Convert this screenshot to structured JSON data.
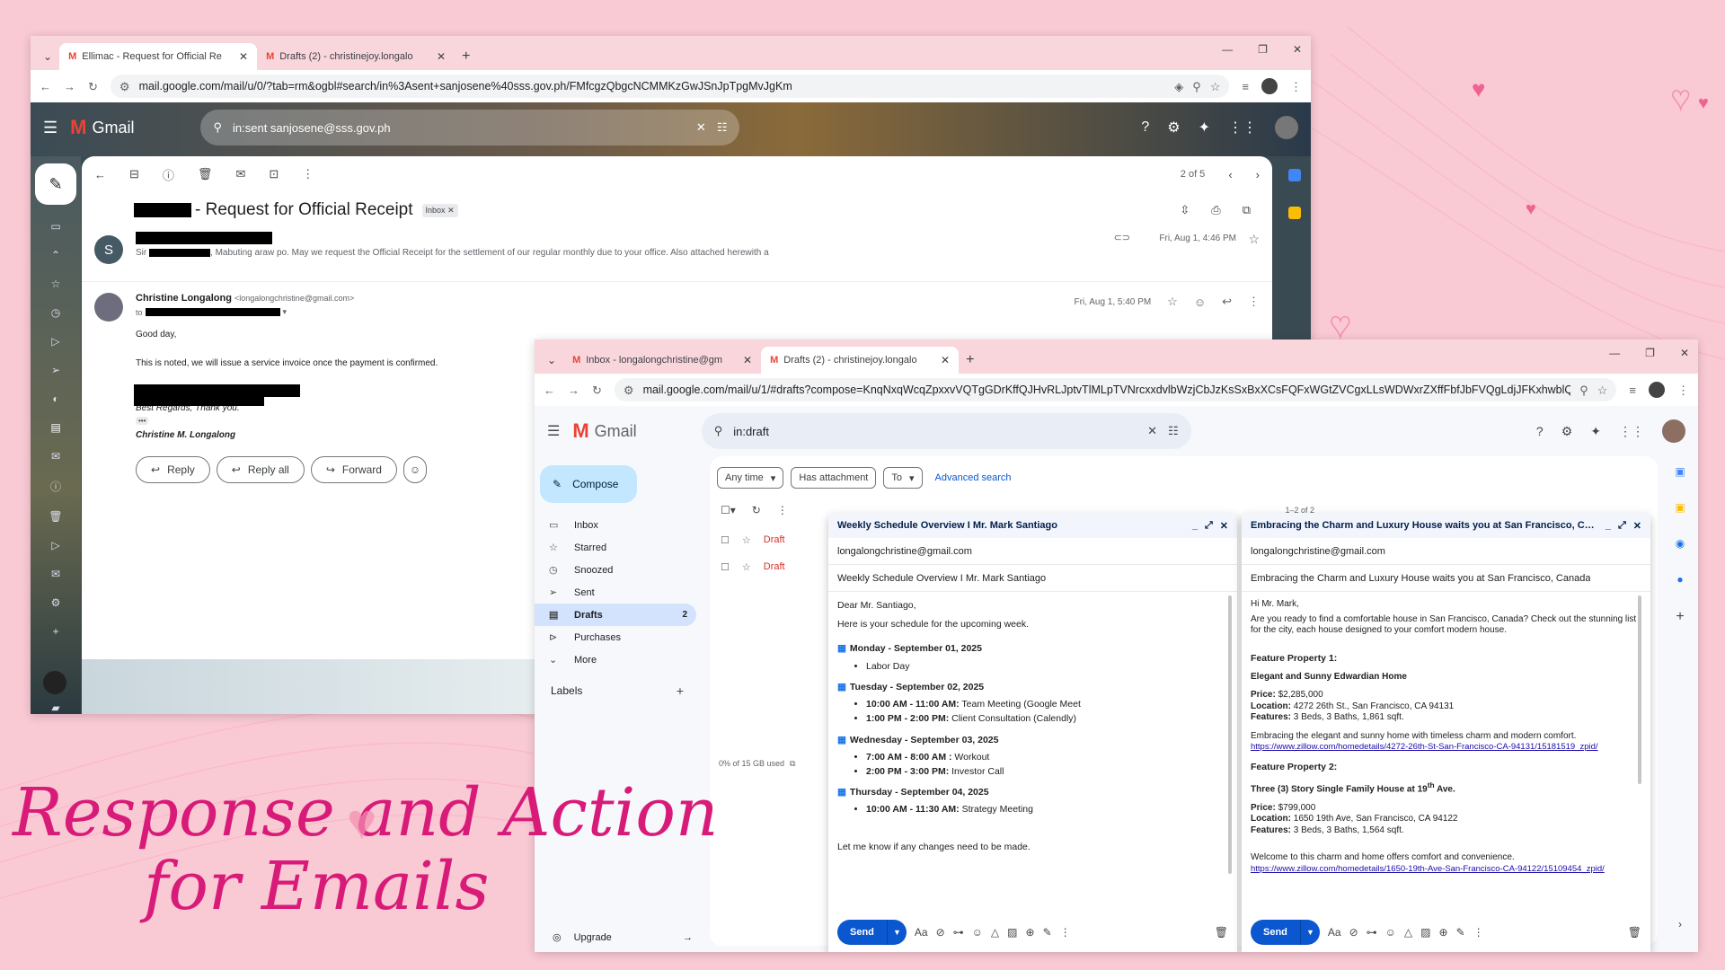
{
  "back_window": {
    "tabs": [
      {
        "label": "Ellimac - Request for Official Re",
        "active": true
      },
      {
        "label": "Drafts (2) - christinejoy.longalo",
        "active": false
      }
    ],
    "url": "mail.google.com/mail/u/0/?tab=rm&ogbl#search/in%3Asent+sanjosene%40sss.gov.ph/FMfcgzQbgcNCMMKzGwJSnJpTpgMvJgKm",
    "app_name": "Gmail",
    "search_query": "in:sent sanjosene@sss.gov.ph",
    "pagination": "2 of 5",
    "subject": "- Request for Official Receipt",
    "inbox_chip": "Inbox",
    "msg1": {
      "avatar_letter": "S",
      "preview_prefix": "Sir",
      "preview": ", Mabuting araw po. May we request the Official Receipt for the settlement of our regular monthly due to your office. Also attached herewith a",
      "time": "Fri, Aug 1, 4:46 PM"
    },
    "msg2": {
      "sender_name": "Christine Longalong",
      "sender_email": "<longalongchristine@gmail.com>",
      "to_prefix": "to",
      "time": "Fri, Aug 1, 5:40 PM",
      "greeting": "Good day,",
      "body": "This is noted, we will issue a service invoice once the payment is confirmed.",
      "closing": "Best Regards, Thank you.",
      "signature": "Christine M. Longalong",
      "ellipsis": "•••"
    },
    "actions": {
      "reply": "Reply",
      "reply_all": "Reply all",
      "forward": "Forward"
    }
  },
  "front_window": {
    "tabs": [
      {
        "label": "Inbox - longalongchristine@gm",
        "active": false
      },
      {
        "label": "Drafts (2) - christinejoy.longalo",
        "active": true
      }
    ],
    "url": "mail.google.com/mail/u/1/#drafts?compose=KnqNxqWcqZpxxvVQTgGDrKffQJHvRLJptvTlMLpTVNrcxxdvlbWzjCbJzKsSxBxXCsFQFxWGtZVCgxLLsWDWxrZXffFbfJbFVQgLdjJFKxhwblQHwkVcpR",
    "app_name": "Gmail",
    "search_query": "in:draft",
    "compose_label": "Compose",
    "nav": [
      {
        "label": "Inbox",
        "icon": "inbox-icon",
        "count": ""
      },
      {
        "label": "Starred",
        "icon": "star-icon",
        "count": ""
      },
      {
        "label": "Snoozed",
        "icon": "clock-icon",
        "count": ""
      },
      {
        "label": "Sent",
        "icon": "send-icon",
        "count": ""
      },
      {
        "label": "Drafts",
        "icon": "draft-icon",
        "count": "2"
      },
      {
        "label": "Purchases",
        "icon": "tag-icon",
        "count": ""
      },
      {
        "label": "More",
        "icon": "chevron-down-icon",
        "count": ""
      }
    ],
    "labels_title": "Labels",
    "upgrade": "Upgrade",
    "filters": {
      "any_time": "Any time",
      "has_attachment": "Has attachment",
      "to": "To",
      "advanced": "Advanced search"
    },
    "list_pagination": "1–2 of 2",
    "draft_label": "Draft",
    "storage": "0% of 15 GB used"
  },
  "compose1": {
    "title": "Weekly Schedule Overview I Mr. Mark Santiago",
    "to": "longalongchristine@gmail.com",
    "subject": "Weekly Schedule Overview I Mr. Mark Santiago",
    "greeting": "Dear Mr. Santiago,",
    "intro": "Here is your schedule for the upcoming week.",
    "days": [
      {
        "heading": "Monday - September 01, 2025",
        "items": [
          {
            "time": "",
            "text": "Labor Day"
          }
        ]
      },
      {
        "heading": "Tuesday - September 02, 2025",
        "items": [
          {
            "time": "10:00 AM - 11:00 AM:",
            "text": " Team Meeting (Google Meet"
          },
          {
            "time": "1:00 PM - 2:00 PM:",
            "text": " Client Consultation (Calendly)"
          }
        ]
      },
      {
        "heading": "Wednesday - September 03, 2025",
        "items": [
          {
            "time": "7:00 AM - 8:00 AM :",
            "text": " Workout"
          },
          {
            "time": "2:00 PM - 3:00 PM:",
            "text": " Investor Call"
          }
        ]
      },
      {
        "heading": "Thursday - September 04, 2025",
        "items": [
          {
            "time": "10:00 AM - 11:30 AM:",
            "text": " Strategy Meeting"
          }
        ]
      }
    ],
    "closing": "Let me know if any changes need to be made.",
    "send": "Send"
  },
  "compose2": {
    "title": "Embracing the Charm and Luxury House waits you at San Francisco, Canada",
    "to": "longalongchristine@gmail.com",
    "subject": "Embracing the Charm and Luxury House waits you at San Francisco, Canada",
    "greeting": "Hi Mr. Mark,",
    "intro": "Are you ready to find a comfortable house in San Francisco, Canada? Check out the stunning list for the city, each house designed to your comfort modern house.",
    "p1_heading": "Feature Property 1:",
    "p1_name": "Elegant and Sunny Edwardian Home",
    "p1_price_label": "Price:",
    "p1_price": " $2,285,000",
    "p1_loc_label": "Location:",
    "p1_loc": " 4272 26th St., San Francisco, CA 94131",
    "p1_feat_label": "Features:",
    "p1_feat": " 3 Beds, 3 Baths, 1,861 sqft.",
    "p1_desc": "Embracing the elegant and sunny home with timeless charm and modern comfort.",
    "p1_link": "https://www.zillow.com/homedetails/4272-26th-St-San-Francisco-CA-94131/15181519_zpid/",
    "p2_heading": "Feature Property 2:",
    "p2_name_a": "Three (3) Story Single Family House at 19",
    "p2_name_sup": "th",
    "p2_name_b": " Ave.",
    "p2_price_label": "Price:",
    "p2_price": " $799,000",
    "p2_loc_label": "Location:",
    "p2_loc": " 1650 19th Ave, San Francisco, CA 94122",
    "p2_feat_label": "Features:",
    "p2_feat": " 3 Beds, 3 Baths, 1,564 sqft.",
    "p2_desc": "Welcome to this charm and home offers comfort and convenience.",
    "p2_link": "https://www.zillow.com/homedetails/1650-19th-Ave-San-Francisco-CA-94122/15109454_zpid/",
    "send": "Send"
  },
  "overlay": {
    "line1": "Response and Action",
    "line2": "for Emails"
  },
  "colors": {
    "background": "#f9c9d4",
    "script": "#d81b78",
    "send": "#0b57d0",
    "draft": "#d93025"
  }
}
